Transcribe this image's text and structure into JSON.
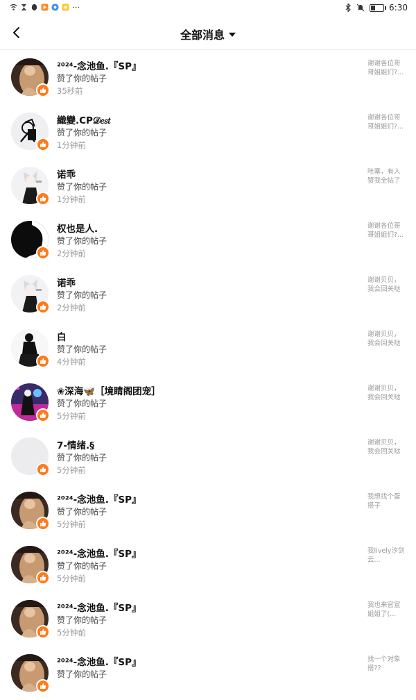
{
  "status_bar": {
    "time": "6:30"
  },
  "header": {
    "title": "全部消息"
  },
  "messages": [
    {
      "name": "²⁰²⁴-念池鱼.『SP』",
      "action": "赞了你的帖子",
      "time": "35秒前",
      "snippet": "谢谢各位哥哥姐姐们?...",
      "avatar": "warm-photo-avatar"
    },
    {
      "name": "織變.CP𝒟𝑒𝑠𝑡",
      "action": "赞了你的帖子",
      "time": "1分钟前",
      "snippet": "谢谢各位哥哥姐姐们?...",
      "avatar": "silhouette-sketch-avatar"
    },
    {
      "name": "诺乖",
      "action": "赞了你的帖子",
      "time": "1分钟前",
      "snippet": "哇塞，有人赞我全帖了",
      "avatar": "anime-avatar"
    },
    {
      "name": "权也是人.",
      "action": "赞了你的帖子",
      "time": "2分钟前",
      "snippet": "谢谢各位哥哥姐姐们?...",
      "avatar": "black-silhouette-avatar"
    },
    {
      "name": "诺乖",
      "action": "赞了你的帖子",
      "time": "2分钟前",
      "snippet": "谢谢贝贝，我会回关哒",
      "avatar": "anime-avatar"
    },
    {
      "name": "白",
      "action": "赞了你的帖子",
      "time": "4分钟前",
      "snippet": "谢谢贝贝，我会回关哒",
      "avatar": "black-dress-avatar"
    },
    {
      "name": "❀深海🦋［境睛阁团宠］",
      "action": "赞了你的帖子",
      "time": "5分钟前",
      "snippet": "谢谢贝贝，我会回关哒",
      "avatar": "neon-anime-avatar"
    },
    {
      "name": "7-情绪.§",
      "action": "赞了你的帖子",
      "time": "5分钟前",
      "snippet": "谢谢贝贝，我会回关哒",
      "avatar": "blank-avatar"
    },
    {
      "name": "²⁰²⁴-念池鱼.『SP』",
      "action": "赞了你的帖子",
      "time": "5分钟前",
      "snippet": "我想找个蛋搭子",
      "avatar": "warm-photo-avatar"
    },
    {
      "name": "²⁰²⁴-念池鱼.『SP』",
      "action": "赞了你的帖子",
      "time": "5分钟前",
      "snippet": "我lively汐剑云...",
      "avatar": "warm-photo-avatar"
    },
    {
      "name": "²⁰²⁴-念池鱼.『SP』",
      "action": "赞了你的帖子",
      "time": "5分钟前",
      "snippet": "我也来官宣姐姐了(...",
      "avatar": "warm-photo-avatar"
    },
    {
      "name": "²⁰²⁴-念池鱼.『SP』",
      "action": "赞了你的帖子",
      "time": "",
      "snippet": "找一个对象 搭??",
      "avatar": "warm-photo-avatar"
    }
  ]
}
